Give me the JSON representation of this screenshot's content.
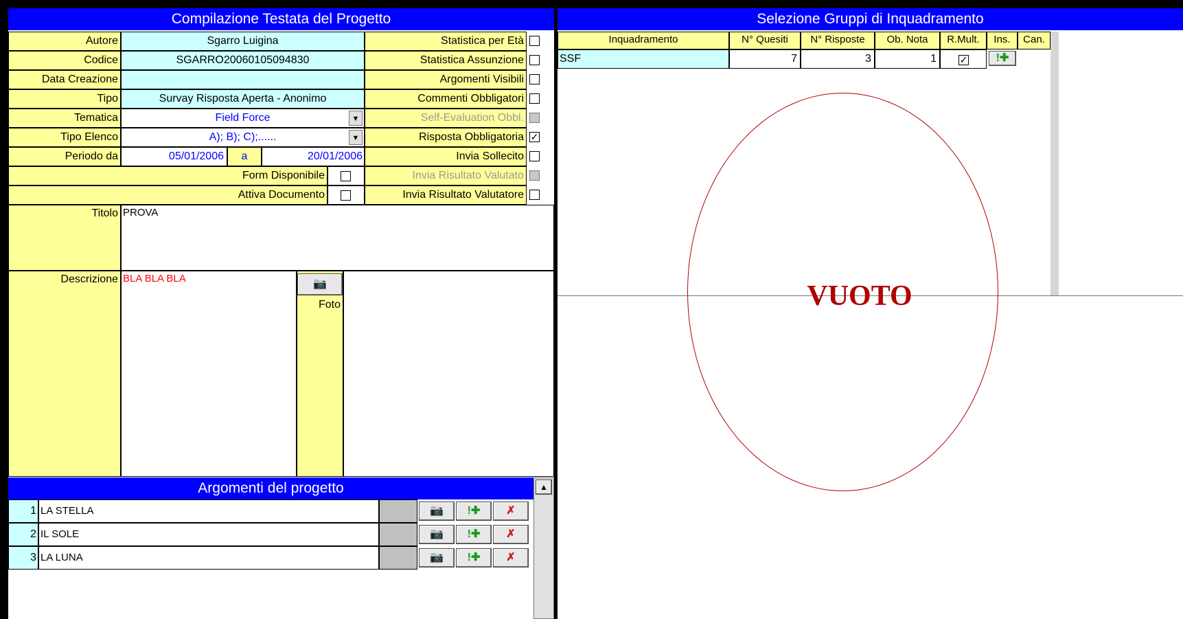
{
  "left_title": "Compilazione Testata del Progetto",
  "right_title": "Selezione Gruppi di Inquadramento",
  "fields": {
    "autore_label": "Autore",
    "autore_value": "Sgarro Luigina",
    "codice_label": "Codice",
    "codice_value": "SGARRO20060105094830",
    "data_label": "Data Creazione",
    "data_value": "",
    "tipo_label": "Tipo",
    "tipo_value": "Survay Risposta Aperta - Anonimo",
    "tematica_label": "Tematica",
    "tematica_value": "Field Force",
    "elenco_label": "Tipo Elenco",
    "elenco_value": "A); B); C);......",
    "periodo_label": "Periodo da",
    "periodo_from": "05/01/2006",
    "periodo_a": "a",
    "periodo_to": "20/01/2006",
    "form_label": "Form Disponibile",
    "attiva_label": "Attiva Documento",
    "titolo_label": "Titolo",
    "titolo_value": "PROVA",
    "descrizione_label": "Descrizione",
    "descrizione_value": "BLA BLA BLA",
    "foto_label": "Foto"
  },
  "options": [
    {
      "label": "Statistica per Età",
      "checked": ""
    },
    {
      "label": "Statistica Assunzione",
      "checked": ""
    },
    {
      "label": "Argomenti Visibili",
      "checked": ""
    },
    {
      "label": "Commenti Obbligatori",
      "checked": ""
    },
    {
      "label": "Self-Evaluation Obbl.",
      "checked": ""
    },
    {
      "label": "Risposta Obbligatoria",
      "checked": "✓"
    },
    {
      "label": "Invia Sollecito",
      "checked": ""
    },
    {
      "label": "Invia Risultato Valutato",
      "checked": ""
    },
    {
      "label": "Invia Risultato Valutatore",
      "checked": ""
    }
  ],
  "table": {
    "headers": [
      "Inquadramento",
      "N° Quesiti",
      "N° Risposte",
      "Ob. Nota",
      "R.Mult.",
      "Ins.",
      "Can."
    ],
    "rows": [
      {
        "inquadramento": "SSF",
        "quesiti": "7",
        "risposte": "3",
        "ob_nota": "1",
        "r_mult": "✓"
      }
    ]
  },
  "annotation": "VUOTO",
  "argomenti_title": "Argomenti del progetto",
  "argomenti": [
    {
      "num": "1",
      "text": "LA STELLA"
    },
    {
      "num": "2",
      "text": "IL SOLE"
    },
    {
      "num": "3",
      "text": "LA LUNA"
    }
  ],
  "icons": {
    "camera": "camera-icon",
    "add": "!✚",
    "delete": "✗"
  },
  "colors": {
    "header_blue": "#0000ff",
    "label_yellow": "#ffff99",
    "value_cyan": "#ccffff",
    "annotation_red": "#b00000"
  }
}
